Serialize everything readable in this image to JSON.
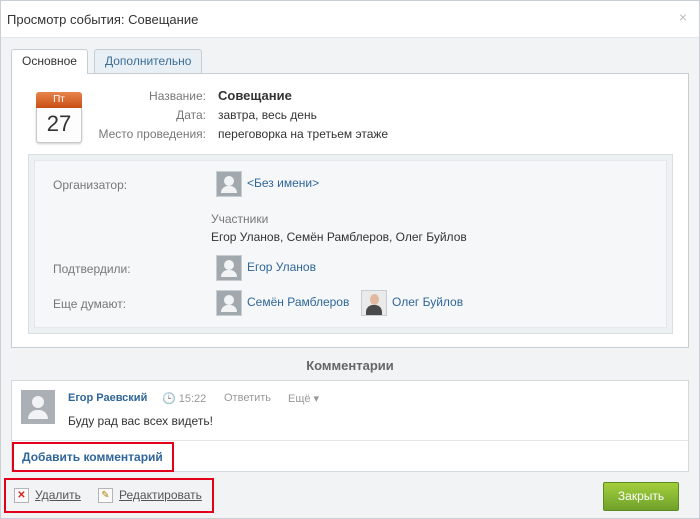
{
  "window": {
    "title": "Просмотр события: Совещание",
    "close_glyph": "×"
  },
  "tabs": [
    {
      "label": "Основное"
    },
    {
      "label": "Дополнительно"
    }
  ],
  "calendar": {
    "weekday": "Пт",
    "day": "27"
  },
  "event": {
    "name_label": "Название:",
    "name": "Совещание",
    "date_label": "Дата:",
    "date": "завтра, весь день",
    "place_label": "Место проведения:",
    "place": "переговорка на третьем этаже"
  },
  "people": {
    "organizer_label": "Организатор:",
    "organizer": "<Без имени>",
    "participants_label": "Участники",
    "participants": "Егор Уланов, Семён Рамблеров, Олег Буйлов",
    "confirmed_label": "Подтвердили:",
    "confirmed": [
      "Егор Уланов"
    ],
    "thinking_label": "Еще думают:",
    "thinking": [
      "Семён Рамблеров",
      "Олег Буйлов"
    ]
  },
  "comments": {
    "title": "Комментарии",
    "items": [
      {
        "author": "Егор Раевский",
        "time": "🕒 15:22",
        "reply": "Ответить",
        "more": "Ещё ▾",
        "text": "Буду рад вас всех видеть!"
      }
    ],
    "add_label": "Добавить комментарий"
  },
  "actions": {
    "delete_label": "Удалить",
    "edit_label": "Редактировать",
    "close_button": "Закрыть"
  },
  "colors": {
    "accent_link": "#2f6699",
    "highlight": "#e2001a",
    "button_green": "#7fb130",
    "calendar_orange": "#d9622a"
  }
}
